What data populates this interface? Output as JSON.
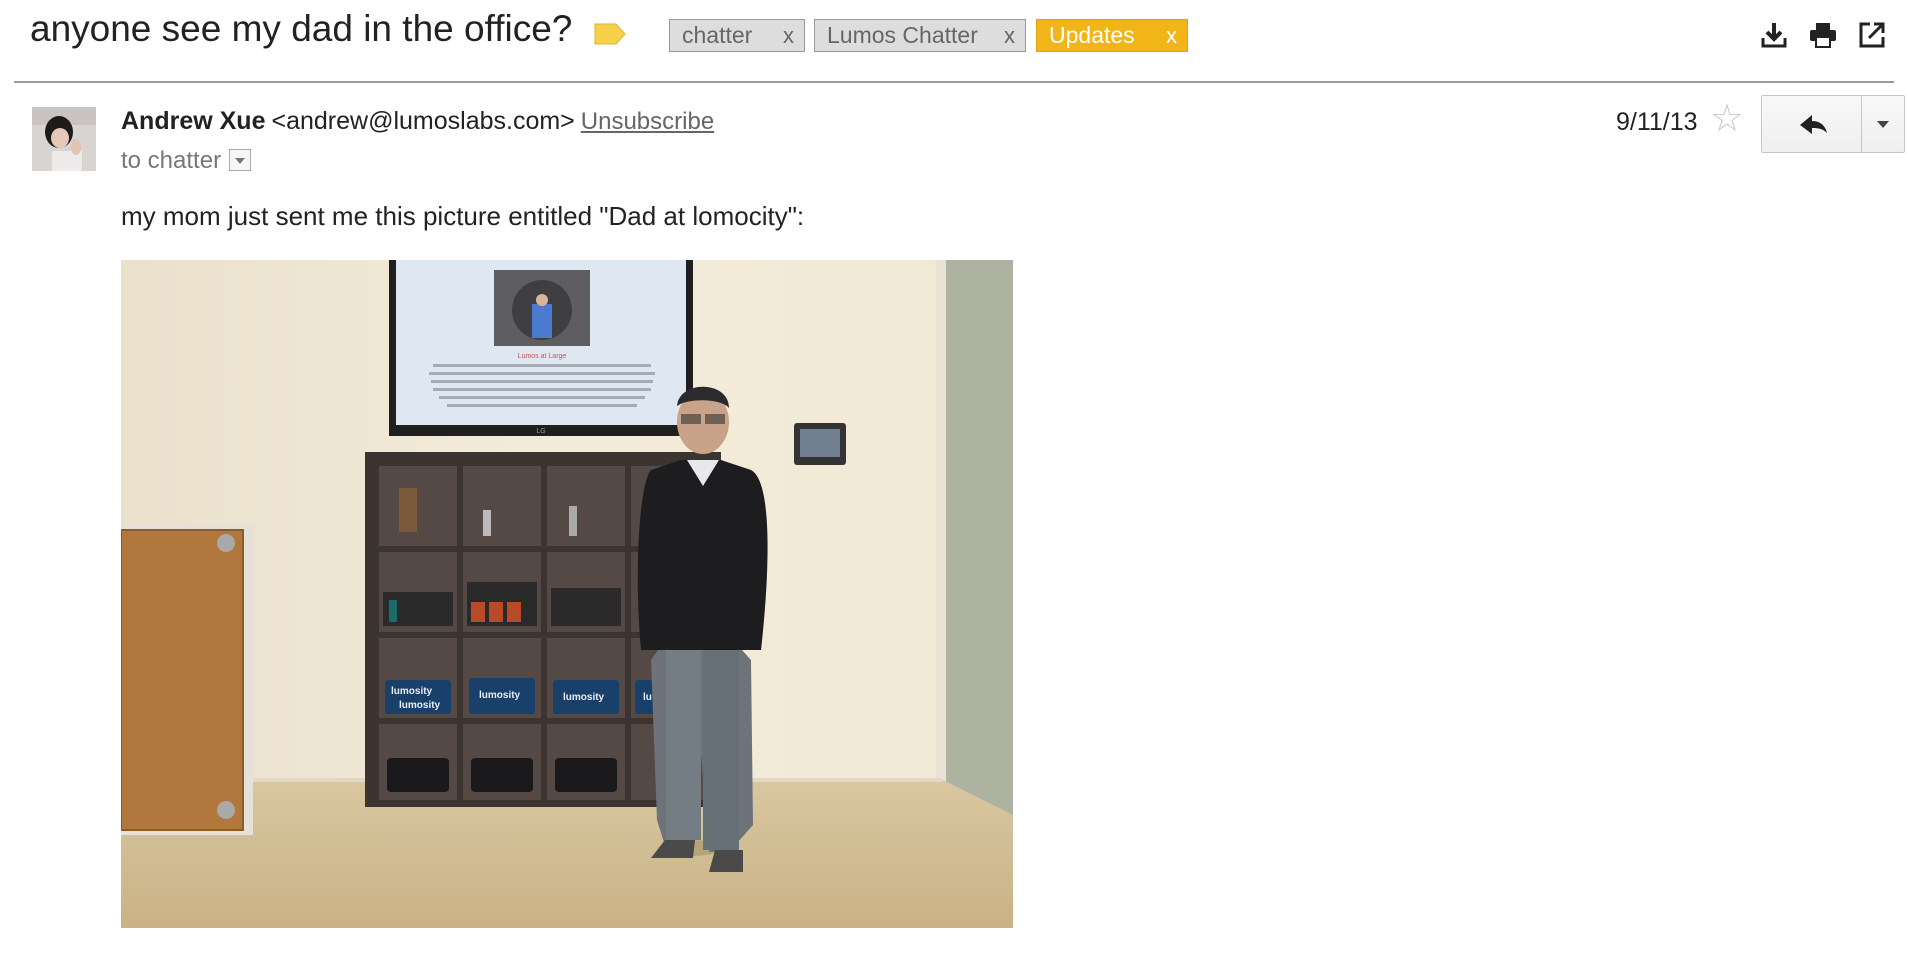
{
  "email": {
    "subject": "anyone see my dad in the office?",
    "labels": [
      {
        "name": "chatter",
        "remove": "x"
      },
      {
        "name": "Lumos Chatter",
        "remove": "x"
      },
      {
        "name": "Updates",
        "remove": "x"
      }
    ],
    "sender_name": "Andrew Xue",
    "sender_email": "<andrew@lumoslabs.com>",
    "unsubscribe": "Unsubscribe",
    "to": "to chatter",
    "date": "9/11/13",
    "body": "my mom just sent me this picture entitled \"Dad at lomocity\":",
    "icons": [
      "label-icon",
      "download-icon",
      "print-icon",
      "new-window-icon",
      "star-icon",
      "reply-icon",
      "more-options-icon",
      "avatar"
    ],
    "photo": {
      "tv_brand": "LG",
      "tv_caption": "Lumos at Large",
      "shirt_texts": [
        "lumosity",
        "lumosity",
        "lumosity",
        "lumosity",
        "lu"
      ]
    }
  },
  "colors": {
    "updates_label": "#f1b518",
    "label_icon": "#f6d24a",
    "chip_bg": "#dddddd"
  }
}
